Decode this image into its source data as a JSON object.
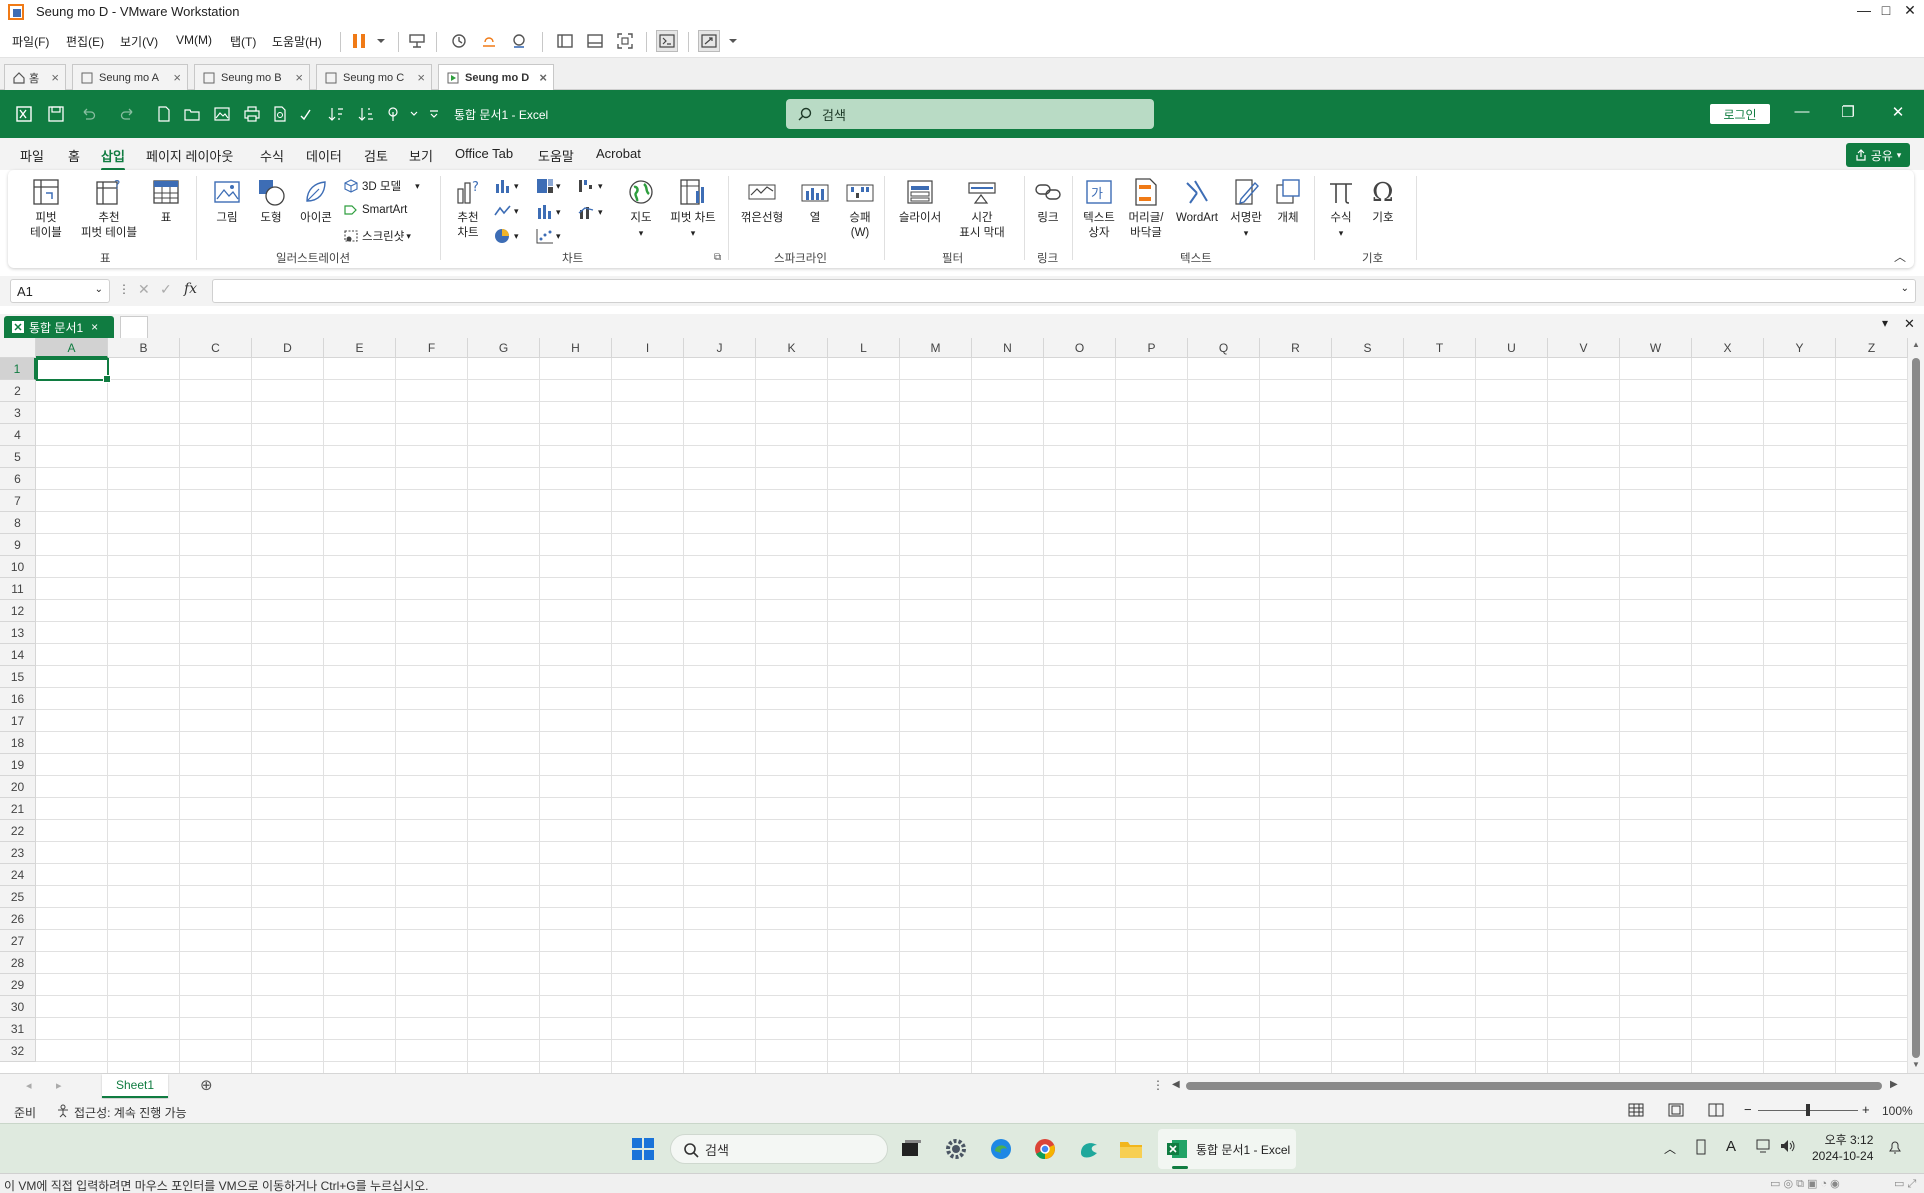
{
  "vmware": {
    "title": "Seung mo D - VMware Workstation",
    "menu": [
      "파일(F)",
      "편집(E)",
      "보기(V)",
      "VM(M)",
      "탭(T)",
      "도움말(H)"
    ],
    "tabs": [
      {
        "label": "홈"
      },
      {
        "label": "Seung mo A"
      },
      {
        "label": "Seung mo B"
      },
      {
        "label": "Seung mo C"
      },
      {
        "label": "Seung mo D"
      }
    ],
    "hint": "이 VM에 직접 입력하려면 마우스 포인터를 VM으로 이동하거나 Ctrl+G를 누르십시오."
  },
  "excel": {
    "doc_title": "통합 문서1  -  Excel",
    "search_placeholder": "검색",
    "login_label": "로그인",
    "ribbon_tabs": [
      "파일",
      "홈",
      "삽입",
      "페이지 레이아웃",
      "수식",
      "데이터",
      "검토",
      "보기",
      "Office Tab",
      "도움말",
      "Acrobat"
    ],
    "share_label": "공유",
    "ribbon": {
      "pivot_table": "피벗\n테이블",
      "recommended_pivot": "추천\n피벗 테이블",
      "table": "표",
      "picture": "그림",
      "shapes": "도형",
      "icons": "아이콘",
      "model3d": "3D 모델",
      "smartart": "SmartArt",
      "screenshot": "스크린샷",
      "recommended_charts": "추천\n차트",
      "maps": "지도",
      "pivot_chart": "피벗 차트",
      "spark_line": "꺾은선형",
      "spark_column": "열",
      "spark_winloss": "승패\n(W)",
      "slicer": "슬라이서",
      "timeline": "시간\n표시 막대",
      "link": "링크",
      "textbox": "텍스트\n상자",
      "header_footer": "머리글/\n바닥글",
      "wordart": "WordArt",
      "signature": "서명란",
      "object": "개체",
      "equation": "수식",
      "symbol": "기호",
      "groups": {
        "tables": "표",
        "illustrations": "일러스트레이션",
        "charts": "차트",
        "sparklines": "스파크라인",
        "filters": "필터",
        "links": "링크",
        "text": "텍스트",
        "symbols": "기호"
      }
    },
    "name_box": "A1",
    "fx_label": "fx",
    "doc_tab": "통합 문서1",
    "columns": [
      "A",
      "B",
      "C",
      "D",
      "E",
      "F",
      "G",
      "H",
      "I",
      "J",
      "K",
      "L",
      "M",
      "N",
      "O",
      "P",
      "Q",
      "R",
      "S",
      "T",
      "U",
      "V",
      "W",
      "X",
      "Y",
      "Z"
    ],
    "rows": [
      "1",
      "2",
      "3",
      "4",
      "5",
      "6",
      "7",
      "8",
      "9",
      "10",
      "11",
      "12",
      "13",
      "14",
      "15",
      "16",
      "17",
      "18",
      "19",
      "20",
      "21",
      "22",
      "23",
      "24",
      "25",
      "26",
      "27",
      "28",
      "29",
      "30",
      "31",
      "32"
    ],
    "sheet_tab": "Sheet1",
    "status_ready": "준비",
    "status_accessibility": "접근성: 계속 진행 가능",
    "zoom": "100%"
  },
  "taskbar": {
    "search": "검색",
    "excel_item": "통합 문서1 - Excel",
    "time": "오후 3:12",
    "date": "2024-10-24"
  },
  "colors": {
    "excel_green": "#107c41",
    "vm_orange": "#f07a16"
  }
}
